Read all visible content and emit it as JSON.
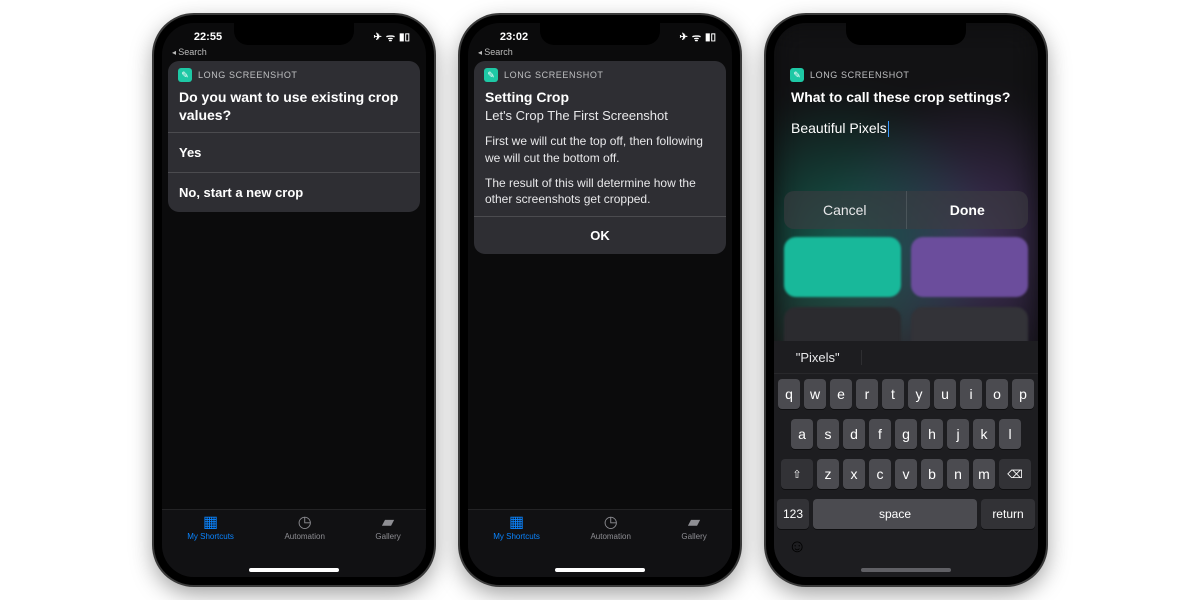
{
  "app_name": "LONG SCREENSHOT",
  "phone1": {
    "time": "22:55",
    "back": "Search",
    "prompt": "Do you want to use existing crop values?",
    "opt1": "Yes",
    "opt2": "No, start a new crop"
  },
  "phone2": {
    "time": "23:02",
    "back": "Search",
    "title": "Setting Crop",
    "sub": "Let's Crop The First Screenshot",
    "p1": "First we will cut the top off, then following we will cut the bottom off.",
    "p2": "The result of this will determine how the other screenshots get cropped.",
    "ok": "OK"
  },
  "phone3": {
    "prompt": "What to call these crop settings?",
    "value": "Beautiful Pixels",
    "cancel": "Cancel",
    "done": "Done",
    "predict": "\"Pixels\"",
    "space": "space",
    "return": "return",
    "numkey": "123"
  },
  "tabs": {
    "my": "My Shortcuts",
    "auto": "Automation",
    "gallery": "Gallery"
  },
  "keys": {
    "r1": [
      "q",
      "w",
      "e",
      "r",
      "t",
      "y",
      "u",
      "i",
      "o",
      "p"
    ],
    "r2": [
      "a",
      "s",
      "d",
      "f",
      "g",
      "h",
      "j",
      "k",
      "l"
    ],
    "r3": [
      "z",
      "x",
      "c",
      "v",
      "b",
      "n",
      "m"
    ]
  }
}
